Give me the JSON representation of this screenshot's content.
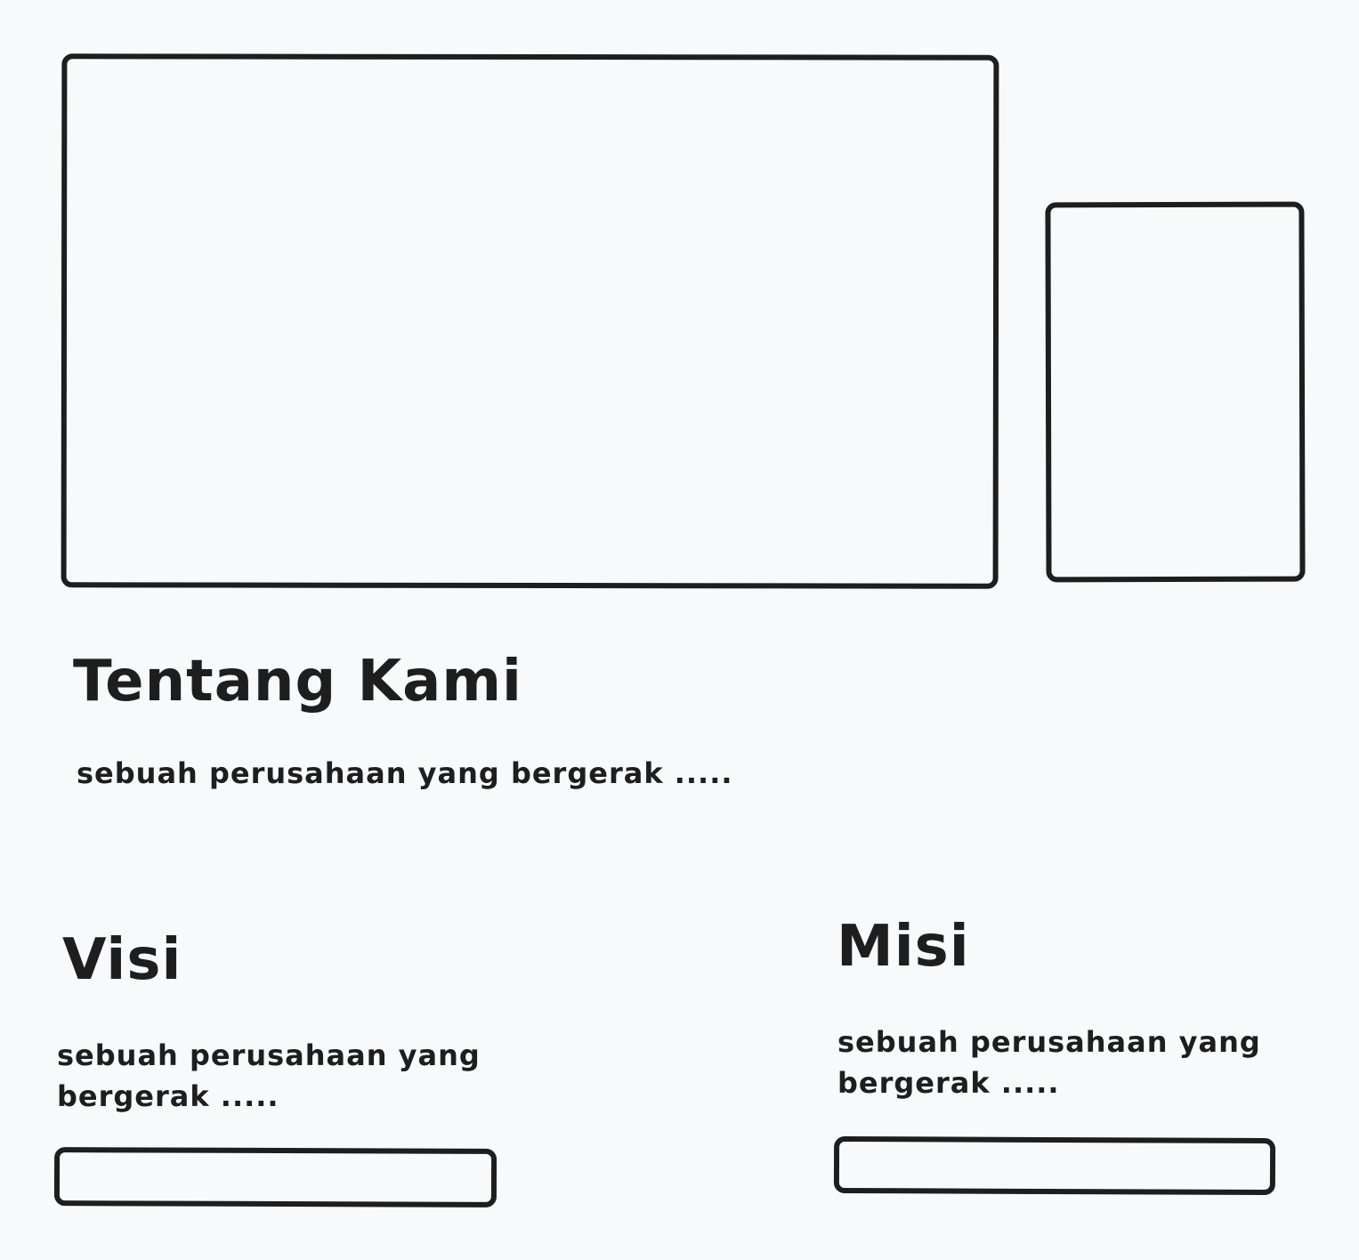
{
  "about": {
    "title": "Tentang Kami",
    "text": "sebuah perusahaan yang bergerak ....."
  },
  "visi": {
    "title": "Visi",
    "text": "sebuah perusahaan yang bergerak ....."
  },
  "misi": {
    "title": "Misi",
    "text": "sebuah perusahaan yang bergerak ....."
  },
  "colors": {
    "background": "#f8f9fa",
    "stroke": "#1e1e1e"
  }
}
